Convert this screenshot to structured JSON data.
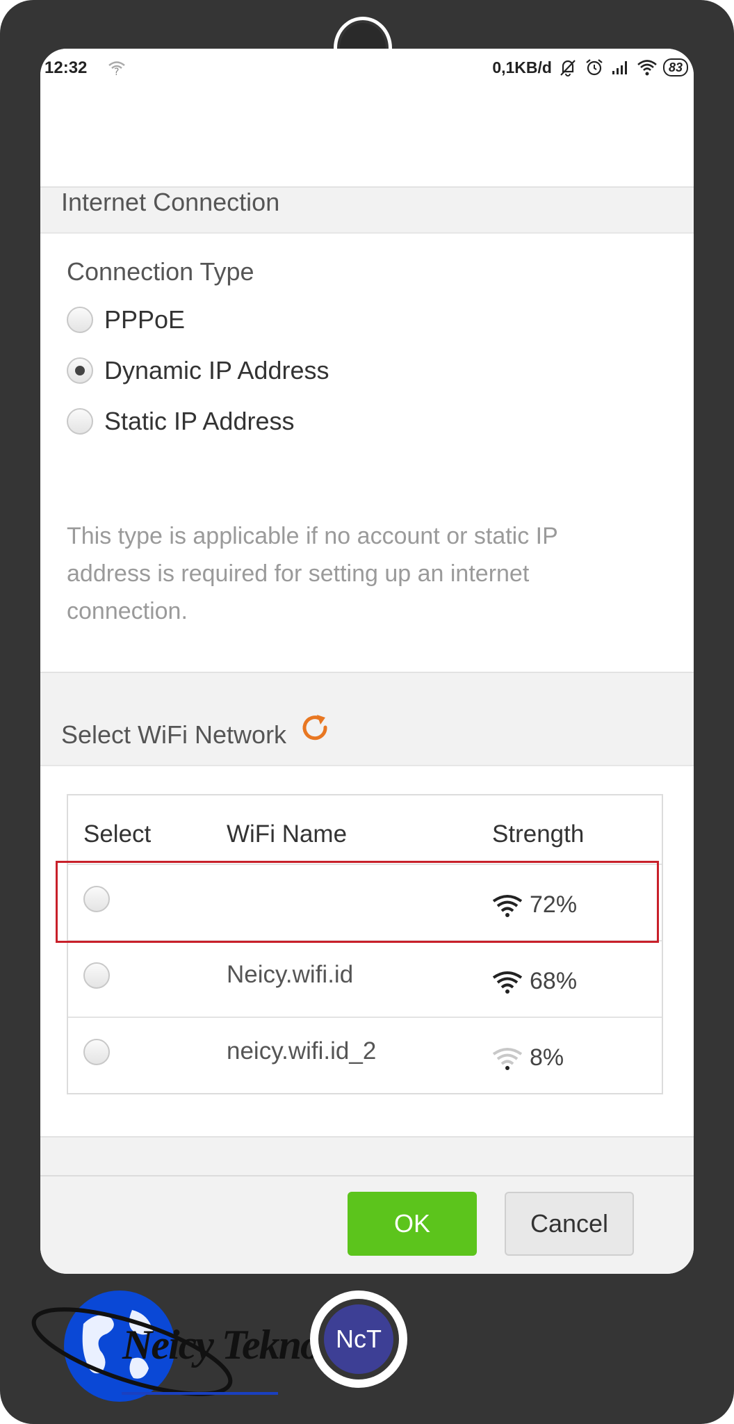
{
  "status_bar": {
    "time": "12:32",
    "speed": "0,1KB/d",
    "battery": "83"
  },
  "internet_section": {
    "title": "Internet Connection"
  },
  "connection": {
    "label": "Connection Type",
    "options": [
      {
        "label": "PPPoE",
        "selected": false
      },
      {
        "label": "Dynamic IP Address",
        "selected": true
      },
      {
        "label": "Static IP Address",
        "selected": false
      }
    ],
    "description": "This type is applicable if no account or static IP address is required for setting up an internet connection."
  },
  "wifi_section": {
    "title": "Select WiFi Network",
    "refresh_icon": "refresh-icon"
  },
  "wifi_table": {
    "headers": {
      "select": "Select",
      "name": "WiFi Name",
      "strength": "Strength"
    },
    "rows": [
      {
        "name": "",
        "strength": "72%",
        "level": 3
      },
      {
        "name": "Neicy.wifi.id",
        "strength": "68%",
        "level": 3
      },
      {
        "name": "neicy.wifi.id_2",
        "strength": "8%",
        "level": 1
      }
    ]
  },
  "buttons": {
    "ok": "OK",
    "cancel": "Cancel"
  },
  "watermark": {
    "brand": "Neicy Tekno",
    "badge": "NcT"
  },
  "colors": {
    "accent_orange": "#e87722",
    "ok_green": "#5cc41c",
    "highlight_red": "#c8202a"
  }
}
